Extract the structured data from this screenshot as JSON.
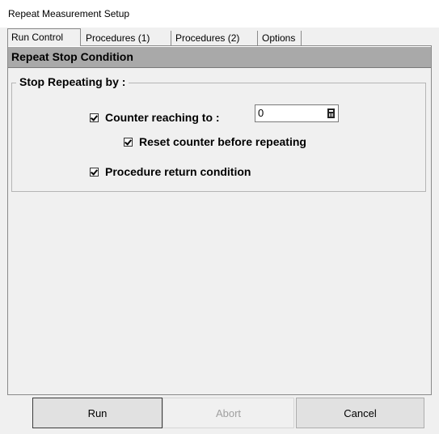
{
  "window": {
    "title": "Repeat Measurement Setup"
  },
  "tabs": [
    {
      "label": "Run Control",
      "active": true
    },
    {
      "label": "Procedures (1)",
      "active": false
    },
    {
      "label": "Procedures (2)",
      "active": false
    },
    {
      "label": "Options",
      "active": false
    }
  ],
  "section": {
    "title": "Repeat Stop Condition"
  },
  "stop_group": {
    "legend": "Stop Repeating by :",
    "counter": {
      "label": "Counter reaching to :",
      "checked": true,
      "value": "0",
      "icon": "calculator-icon"
    },
    "reset": {
      "label": "Reset counter before repeating",
      "checked": true
    },
    "procedure": {
      "label": "Procedure return condition",
      "checked": true
    }
  },
  "buttons": {
    "run": "Run",
    "abort": "Abort",
    "cancel": "Cancel"
  },
  "colors": {
    "header_bg": "#a9a9a9",
    "window_bg": "#f0f0f0"
  }
}
